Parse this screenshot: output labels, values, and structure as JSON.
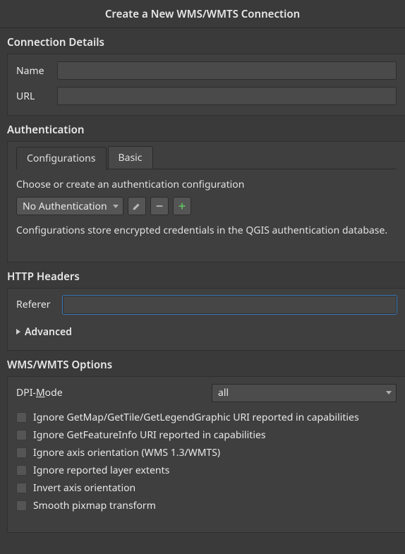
{
  "title": "Create a New WMS/WMTS Connection",
  "sections": {
    "connection_details": "Connection Details",
    "authentication": "Authentication",
    "http_headers": "HTTP Headers",
    "options": "WMS/WMTS Options"
  },
  "connection": {
    "name_label": "Name",
    "name_value": "",
    "url_label": "URL",
    "url_value": ""
  },
  "auth": {
    "tabs": {
      "configurations": "Configurations",
      "basic": "Basic"
    },
    "choose": "Choose or create an authentication configuration",
    "combo_value": "No Authentication",
    "hint": "Configurations store encrypted credentials in the QGIS authentication database."
  },
  "http": {
    "referer_label": "Referer",
    "referer_value": "",
    "advanced": "Advanced"
  },
  "options_fields": {
    "dpi_label_pre": "DPI-",
    "dpi_label_ul": "M",
    "dpi_label_post": "ode",
    "dpi_value": "all",
    "checks": [
      "Ignore GetMap/GetTile/GetLegendGraphic URI reported in capabilities",
      "Ignore GetFeatureInfo URI reported in capabilities",
      "Ignore axis orientation (WMS 1.3/WMTS)",
      "Ignore reported layer extents",
      "Invert axis orientation",
      "Smooth pixmap transform"
    ]
  }
}
